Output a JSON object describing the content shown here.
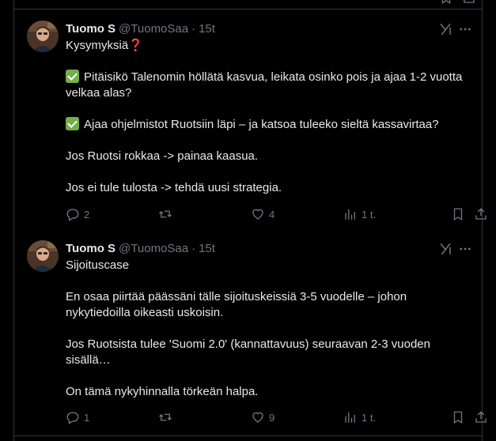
{
  "tweets": [
    {
      "author_name": "Tuomo S",
      "handle": "@TuomoSaa",
      "separator": "·",
      "time": "15t",
      "lines": {
        "l1": "Kysymyksiä",
        "l2a": "Pitäisikö Talenomin höllätä kasvua, leikata osinko pois ja ajaa 1-2 vuotta",
        "l2b": "velkaa alas?",
        "l3": "Ajaa ohjelmistot Ruotsiin läpi – ja katsoa tuleeko sieltä kassavirtaa?",
        "l4": "Jos Ruotsi rokkaa -> painaa kaasua.",
        "l5": "Jos ei tule tulosta -> tehdä uusi strategia."
      },
      "replies": "2",
      "reposts": "",
      "likes": "4",
      "views": "1 t."
    },
    {
      "author_name": "Tuomo S",
      "handle": "@TuomoSaa",
      "separator": "·",
      "time": "15t",
      "lines": {
        "l1": "Sijoituscase",
        "l2a": "En osaa piirtää päässäni tälle sijoituskeissiä 3-5 vuodelle – johon",
        "l2b": "nykytiedoilla oikeasti uskoisin.",
        "l3a": "Jos Ruotsista tulee 'Suomi 2.0' (kannattavuus) seuraavan 2-3 vuoden",
        "l3b": "sisällä…",
        "l4": "On tämä nykyhinnalla törkeän halpa."
      },
      "replies": "1",
      "reposts": "",
      "likes": "9",
      "views": "1 t."
    }
  ],
  "icons": {
    "reply": "reply-icon",
    "repost": "repost-icon",
    "like": "heart-icon",
    "views": "views-icon",
    "bookmark": "bookmark-icon",
    "share": "share-icon",
    "grok": "grok-icon",
    "more": "more-icon"
  },
  "colors": {
    "background": "#000000",
    "text": "#e7e9ea",
    "secondary": "#71767b",
    "border": "#2f3336",
    "check_emoji": "#74ad4b",
    "question_emoji": "#dd2e44"
  },
  "emoji": {
    "question": "❓"
  }
}
